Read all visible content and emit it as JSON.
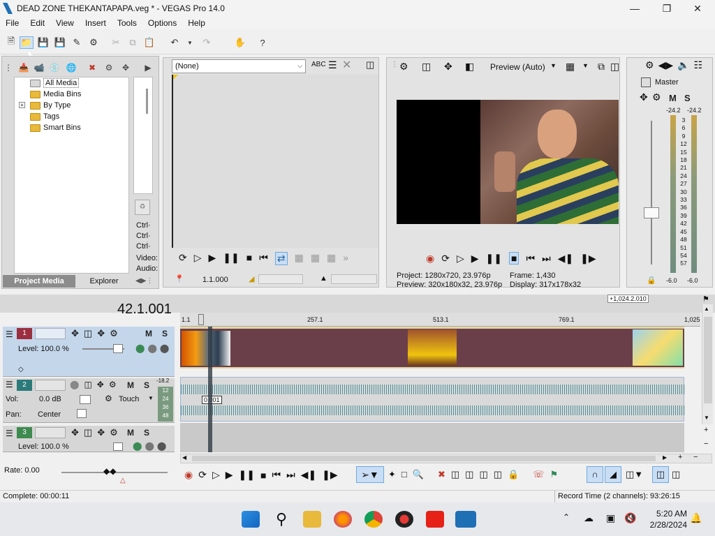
{
  "window": {
    "title": "DEAD ZONE THEKANTAPAPA.veg * - VEGAS Pro 14.0"
  },
  "menu": [
    "File",
    "Edit",
    "View",
    "Insert",
    "Tools",
    "Options",
    "Help"
  ],
  "project_media": {
    "tree": [
      "All Media",
      "Media Bins",
      "By Type",
      "Tags",
      "Smart Bins"
    ],
    "expand_symbol": "+",
    "tabs": [
      "Project Media",
      "Explorer"
    ],
    "side_labels": [
      "Ctrl·",
      "Ctrl·",
      "Ctrl·",
      "Video:",
      "Audio:"
    ]
  },
  "trimmer": {
    "dropdown": "(None)",
    "timecode": "1.1.000"
  },
  "preview": {
    "mode": "Preview (Auto)",
    "project_label": "Project:",
    "project_value": "1280x720, 23.976p",
    "preview_label": "Preview:",
    "preview_value": "320x180x32, 23.976p",
    "frame_label": "Frame:",
    "frame_value": "1,430",
    "display_label": "Display:",
    "display_value": "317x178x32"
  },
  "mixer": {
    "master": "Master",
    "mute": "M",
    "solo": "S",
    "peak_left": "-24.2",
    "peak_right": "-24.2",
    "scale": [
      "3",
      "6",
      "9",
      "12",
      "15",
      "18",
      "21",
      "24",
      "27",
      "30",
      "33",
      "36",
      "39",
      "42",
      "45",
      "48",
      "51",
      "54",
      "57"
    ],
    "bottom_left": "-6.0",
    "bottom_right": "-6.0"
  },
  "timeline": {
    "cursor_time": "42.1.001",
    "range_label": "+1,024.2.010",
    "ruler": [
      "1.1",
      "257.1",
      "513.1",
      "769.1",
      "1,025"
    ],
    "tracks": [
      {
        "num": "1",
        "level": "Level: 100.0 %",
        "m": "M",
        "s": "S"
      },
      {
        "num": "2",
        "vol_label": "Vol:",
        "vol_value": "0.0 dB",
        "pan_label": "Pan:",
        "pan_value": "Center",
        "touch": "Touch",
        "m": "M",
        "s": "S",
        "meter_top": "-18.2",
        "meter_marks": [
          "12",
          "24",
          "36",
          "48"
        ]
      },
      {
        "num": "3",
        "level": "Level: 100.0 %",
        "m": "M",
        "s": "S"
      }
    ],
    "audio_marker": "0.001",
    "rate": "Rate: 0.00"
  },
  "status": {
    "left": "Complete: 00:00:11",
    "right": "Record Time (2 channels): 93:26:15"
  },
  "taskbar": {
    "time": "5:20 AM",
    "date": "2/28/2024"
  }
}
